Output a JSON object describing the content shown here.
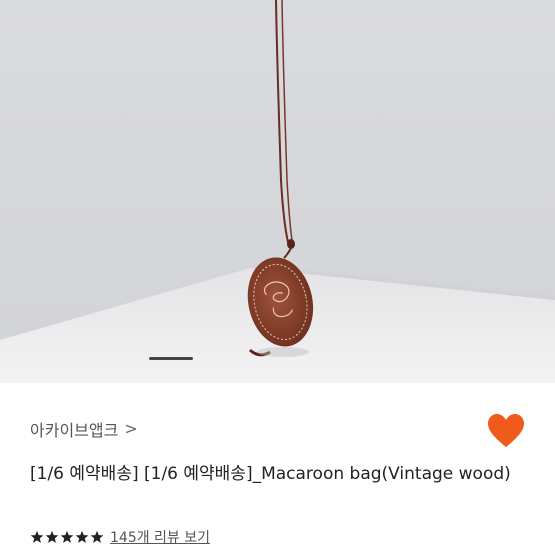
{
  "product": {
    "store_name": "아카이브앱크",
    "store_chevron": ">",
    "title": "[1/6 예약배송] [1/6 예약배송]_Macaroon bag(Vintage wood)",
    "rating": 5,
    "review_text": "145개 리뷰 보기",
    "favorited": true
  },
  "colors": {
    "heart": "#f05a1a",
    "star": "#222222"
  },
  "icons": {
    "heart": "heart-icon",
    "star": "star-icon",
    "chevron": "chevron-right-icon"
  }
}
